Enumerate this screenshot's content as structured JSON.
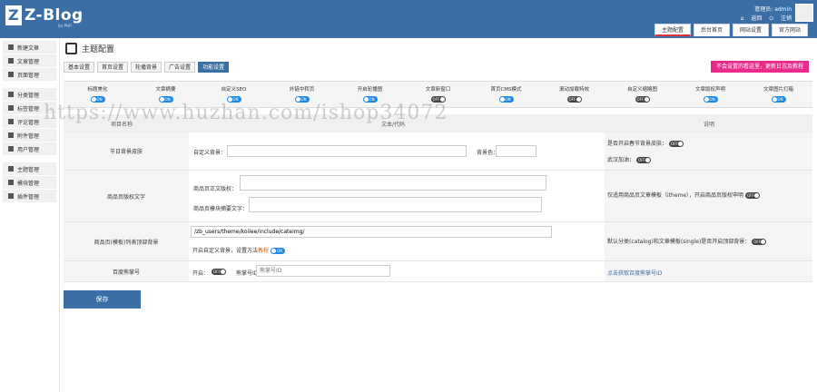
{
  "header": {
    "logo": "Z-Blog",
    "logo_sub": "for PHP",
    "user_text": "管理员: admin",
    "back": "返回",
    "logout": "注销",
    "tabs": [
      "主题配置",
      "后台首页",
      "网站设置",
      "官方网站"
    ]
  },
  "sidebar": {
    "items": [
      "新建文章",
      "文章管理",
      "页面管理",
      "分类管理",
      "标签管理",
      "评论管理",
      "附件管理",
      "用户管理",
      "主题管理",
      "模块管理",
      "插件管理"
    ]
  },
  "main": {
    "title": "主题配置",
    "subtabs": [
      "基本设置",
      "首页设置",
      "轮播背景",
      "广告设置",
      "功能设置"
    ],
    "help_button": "不会设置的看这里，更新日志及教程",
    "toggles": [
      {
        "label": "标题美化",
        "state": "ON"
      },
      {
        "label": "文章摘要",
        "state": "ON"
      },
      {
        "label": "自定义SEO",
        "state": "ON"
      },
      {
        "label": "外链中转页",
        "state": "ON"
      },
      {
        "label": "开启轮播图",
        "state": "ON"
      },
      {
        "label": "文章新窗口",
        "state": "OFF"
      },
      {
        "label": "首页CMS模式",
        "state": "ON"
      },
      {
        "label": "滚动加载特效",
        "state": "OFF"
      },
      {
        "label": "自定义缩略图",
        "state": "OFF"
      },
      {
        "label": "文章版权声明",
        "state": "ON"
      },
      {
        "label": "文章图片灯箱",
        "state": "ON"
      }
    ],
    "table_head": {
      "name": "项目名称",
      "content": "文本/代码",
      "note": "说明"
    },
    "rows": {
      "festival": {
        "name": "节日背景皮肤",
        "custom_bg_label": "自定义背景：",
        "bg_color_label": "背景色：",
        "desc1": "是否开启春节背景皮肤：",
        "desc1_state": "OFF",
        "desc2": "武汉加油：",
        "desc2_state": "OFF"
      },
      "product": {
        "name": "商品页版权文字",
        "label1": "商品页正文版权：",
        "label2": "商品页模块摘要文字：",
        "desc": "仅适用商品页文章模板（itheme），开启商品页版权申明",
        "desc_state": "OFF"
      },
      "category": {
        "name": "商品页(模板)列表顶部背景",
        "path_value": "/zb_users/theme/koilee/include/cateimg/",
        "note": "开启自定义背景，设置方法",
        "note_link": "教程",
        "note_state": "ON",
        "desc": "默认分类(catalog)和文章模板(single)是否开启顶部背景：",
        "desc_state": "OFF"
      },
      "baidu": {
        "name": "百度熊掌号",
        "enable_label": "开启：",
        "enable_state": "OFF",
        "id_label": "熊掌号ID：",
        "id_placeholder": "熊掌号ID",
        "desc_link": "点击获取百度熊掌号ID"
      }
    },
    "save": "保存"
  },
  "watermark": "https://www.huzhan.com/ishop34072"
}
